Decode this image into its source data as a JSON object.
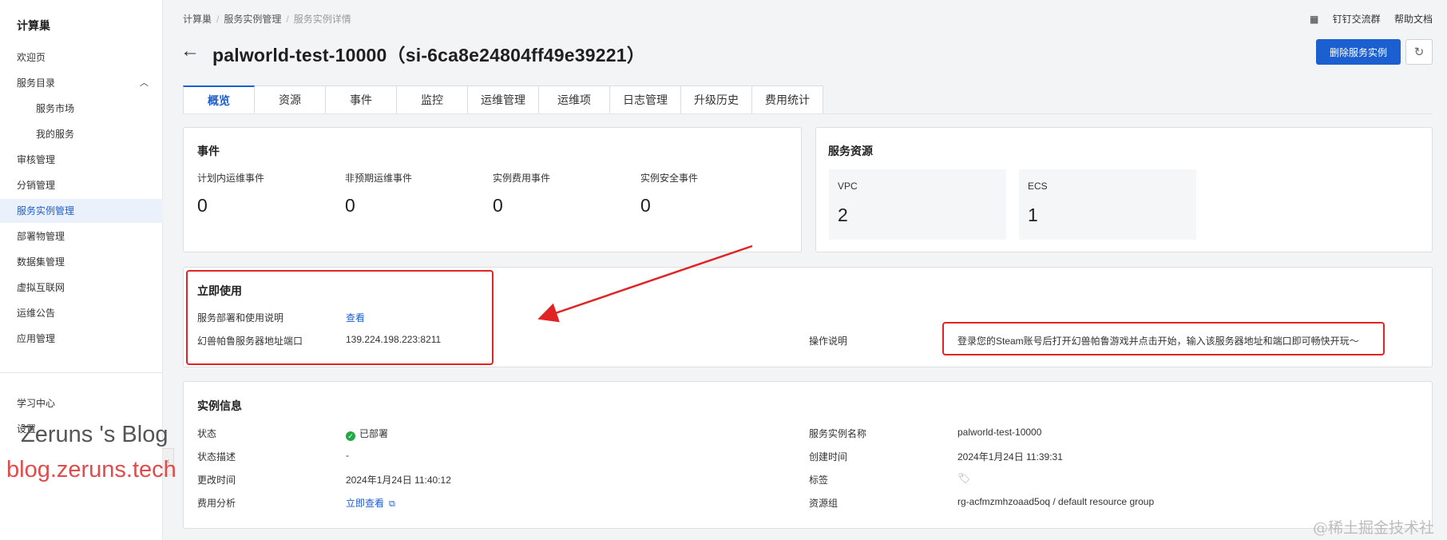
{
  "sidebar": {
    "brand": "计算巢",
    "items": [
      {
        "label": "欢迎页"
      },
      {
        "label": "服务目录"
      },
      {
        "label": "服务市场"
      },
      {
        "label": "我的服务"
      },
      {
        "label": "审核管理"
      },
      {
        "label": "分销管理"
      },
      {
        "label": "服务实例管理"
      },
      {
        "label": "部署物管理"
      },
      {
        "label": "数据集管理"
      },
      {
        "label": "虚拟互联网"
      },
      {
        "label": "运维公告"
      },
      {
        "label": "应用管理"
      },
      {
        "label": "学习中心"
      },
      {
        "label": "设置"
      }
    ]
  },
  "breadcrumb": [
    "计算巢",
    "服务实例管理",
    "服务实例详情"
  ],
  "top_links": [
    "钉钉交流群",
    "帮助文档"
  ],
  "title": "palworld-test-10000（si-6ca8e24804ff49e39221）",
  "actions": {
    "delete": "删除服务实例"
  },
  "tabs": [
    "概览",
    "资源",
    "事件",
    "监控",
    "运维管理",
    "运维项",
    "日志管理",
    "升级历史",
    "费用统计"
  ],
  "events": {
    "title": "事件",
    "items": [
      {
        "label": "计划内运维事件",
        "value": "0"
      },
      {
        "label": "非预期运维事件",
        "value": "0"
      },
      {
        "label": "实例费用事件",
        "value": "0"
      },
      {
        "label": "实例安全事件",
        "value": "0"
      }
    ]
  },
  "resources": {
    "title": "服务资源",
    "items": [
      {
        "label": "VPC",
        "value": "2"
      },
      {
        "label": "ECS",
        "value": "1"
      }
    ]
  },
  "quickstart": {
    "title": "立即使用",
    "rows": [
      {
        "label": "服务部署和使用说明",
        "value": "查看"
      },
      {
        "label": "幻兽帕鲁服务器地址端口",
        "value": "139.224.198.223:8211"
      }
    ],
    "op_label": "操作说明",
    "op_value": "登录您的Steam账号后打开幻兽帕鲁游戏并点击开始，输入该服务器地址和端口即可畅快开玩～"
  },
  "instance": {
    "title": "实例信息",
    "status_label": "状态",
    "status_value": "已部署",
    "desc_label": "状态描述",
    "desc_value": "-",
    "modified_label": "更改时间",
    "modified_value": "2024年1月24日 11:40:12",
    "cost_label": "费用分析",
    "cost_value": "立即查看",
    "name_label": "服务实例名称",
    "name_value": "palworld-test-10000",
    "created_label": "创建时间",
    "created_value": "2024年1月24日 11:39:31",
    "tags_label": "标签",
    "rg_label": "资源组",
    "rg_value": "rg-acfmzmhzoaad5oq / default resource group"
  },
  "watermarks": [
    "Zeruns 's Blog",
    "blog.zeruns.tech",
    "@稀土掘金技术社区"
  ],
  "colors": {
    "primary": "#1b5fd0",
    "annotation": "#e02424",
    "success": "#22a845"
  }
}
